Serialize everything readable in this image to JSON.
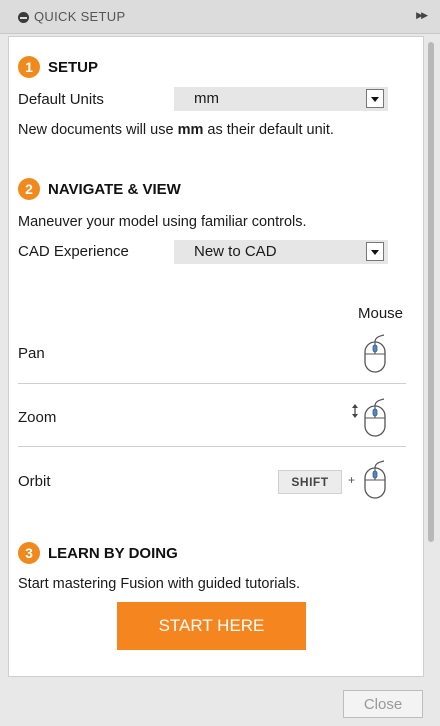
{
  "window": {
    "title": "QUICK SETUP"
  },
  "setup": {
    "number": "1",
    "heading": "SETUP",
    "units_label": "Default Units",
    "units_value": "mm",
    "note_prefix": "New documents will use ",
    "note_unit": "mm",
    "note_suffix": " as their default unit."
  },
  "navigate": {
    "number": "2",
    "heading": "NAVIGATE & VIEW",
    "description": "Maneuver your model using familiar controls.",
    "cad_label": "CAD Experience",
    "cad_value": "New to CAD",
    "mouse_header": "Mouse",
    "controls": [
      {
        "label": "Pan",
        "icon": "mouse-pan-icon"
      },
      {
        "label": "Zoom",
        "icon": "mouse-scroll-icon"
      },
      {
        "label": "Orbit",
        "icon": "mouse-orbit-icon",
        "modifier": "SHIFT",
        "plus": "+"
      }
    ]
  },
  "learn": {
    "number": "3",
    "heading": "LEARN BY DOING",
    "description": "Start mastering Fusion with guided tutorials.",
    "button_label": "START HERE"
  },
  "footer": {
    "close_label": "Close"
  },
  "colors": {
    "accent": "#f5851f",
    "number_badge": "#f08a1c",
    "mouse_highlight": "#3d8bd9"
  }
}
